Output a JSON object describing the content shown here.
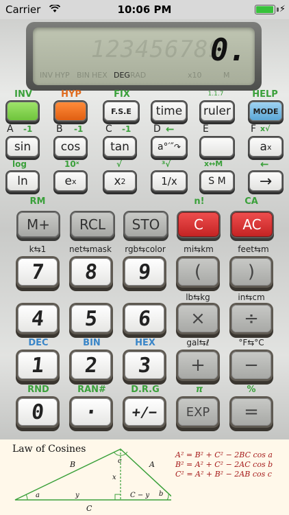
{
  "status": {
    "carrier": "Carrier",
    "time": "10:06 PM"
  },
  "display": {
    "value": "0.",
    "ghost_digits": "123456789",
    "indicators": [
      "INV",
      "HYP",
      "BIN",
      "HEX",
      "DEG",
      "RAD",
      "x10",
      "M"
    ],
    "active_indicator": "DEG"
  },
  "row1": {
    "labels": [
      "INV",
      "HYP",
      "FIX",
      "1.1.7",
      "HELP"
    ],
    "keys": [
      "",
      "",
      "F.S.E",
      "time",
      "ruler",
      "MODE"
    ]
  },
  "row2": {
    "top": [
      "A",
      "-1",
      "B",
      "-1",
      "C",
      "-1",
      "D",
      "←",
      "E",
      "F",
      "x√"
    ],
    "keys": [
      "sin",
      "cos",
      "tan",
      "a°′″",
      "",
      "a"
    ]
  },
  "row3": {
    "top": [
      "log",
      "10ˣ",
      "√",
      "³√",
      "x↔M",
      "←"
    ],
    "keys": [
      "ln",
      "e",
      "x",
      "1/x",
      "S M",
      "→"
    ]
  },
  "row4": {
    "top": [
      "RM",
      "n!",
      "CA"
    ],
    "keys": [
      "M+",
      "RCL",
      "STO",
      "C",
      "AC"
    ]
  },
  "row5": {
    "top": [
      "k⇆1",
      "net⇆mask",
      "rgb⇆color",
      "mi⇆km",
      "feet⇆m"
    ],
    "keys": [
      "7",
      "8",
      "9",
      "(",
      ")"
    ]
  },
  "row6": {
    "top": [
      "lb⇆kg",
      "in⇆cm"
    ],
    "keys": [
      "4",
      "5",
      "6",
      "×",
      "÷"
    ]
  },
  "row7": {
    "top": [
      "DEC",
      "BIN",
      "HEX",
      "gal⇆ℓ",
      "°F⇆°C"
    ],
    "keys": [
      "1",
      "2",
      "3",
      "+",
      "−"
    ]
  },
  "row8": {
    "top": [
      "RND",
      "RAN#",
      "D.R.G",
      "π",
      "%"
    ],
    "keys": [
      "0",
      "·",
      "+/−",
      "EXP",
      "="
    ]
  },
  "panel": {
    "title": "Law of Cosines",
    "formulas": [
      "A² = B² + C² − 2BC cos a",
      "B² = A² + C² − 2AC cos b",
      "C² = A² + B² − 2AB cos c"
    ],
    "labels": {
      "A": "A",
      "B": "B",
      "C": "C",
      "a": "a",
      "b": "b",
      "c": "c",
      "x": "x",
      "y": "y",
      "cy": "C − y"
    }
  },
  "colors": {
    "green": "#6fc43c",
    "orange": "#e05f12",
    "red": "#c42424",
    "mode": "#5ba7d6",
    "panel_bg": "#fff8ea"
  }
}
